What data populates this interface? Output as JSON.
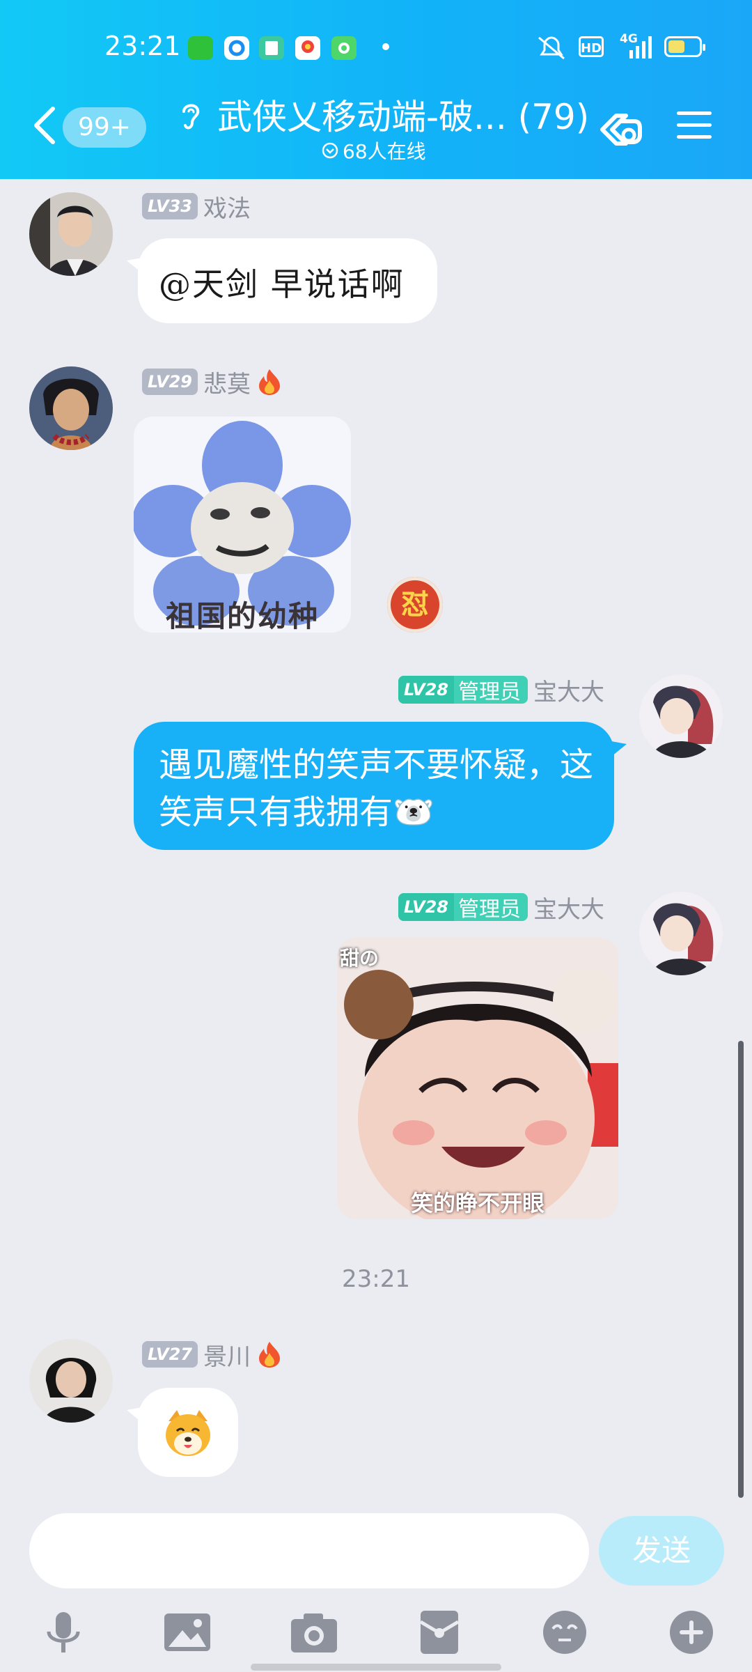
{
  "status_bar": {
    "time": "23:21",
    "hd_label": "HD",
    "network_label": "4G",
    "battery_level": 0.55
  },
  "header": {
    "unread_badge": "99+",
    "group_title": "武侠乂移动端-破... (79)",
    "online_text": "68人在线"
  },
  "messages": [
    {
      "level": "LV33",
      "sender": "戏法",
      "text": "@天剑 早说话啊"
    },
    {
      "level": "LV29",
      "sender": "悲莫",
      "sticker_caption": "祖国的幼种",
      "reaction_glyph": "怼"
    },
    {
      "level": "LV28",
      "role": "管理员",
      "sender": "宝大大",
      "text": "遇见魔性的笑声不要怀疑，这笑声只有我拥有🐻‍❄️"
    },
    {
      "level": "LV28",
      "role": "管理员",
      "sender": "宝大大",
      "sticker_top": "甜の",
      "sticker_caption": "笑的睁不开眼"
    },
    {
      "level": "LV27",
      "sender": "景川"
    }
  ],
  "timestamp": "23:21",
  "input": {
    "placeholder": "",
    "send_label": "发送"
  },
  "icons": {
    "back": "chevron-left-icon",
    "ear": "ear-icon",
    "link": "link-icon",
    "menu": "menu-icon",
    "mic": "microphone-icon",
    "image": "image-icon",
    "camera": "camera-icon",
    "gift": "red-packet-icon",
    "emoji": "emoji-icon",
    "plus": "plus-icon"
  },
  "colors": {
    "header": "#12b3f8",
    "own_bubble": "#18b1f7",
    "admin_badge": "#3fd0b6",
    "send_button": "#b9ecfb"
  }
}
